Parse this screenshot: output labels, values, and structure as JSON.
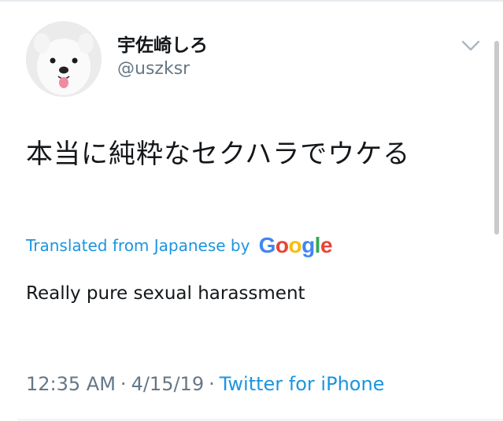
{
  "user": {
    "display_name": "宇佐崎しろ",
    "handle": "@uszksr",
    "avatar_icon": "white-dog-avatar-icon"
  },
  "tweet": {
    "text": "本当に純粋なセクハラでウケる"
  },
  "translation": {
    "label": "Translated from Japanese by",
    "provider_letters": [
      "G",
      "o",
      "o",
      "g",
      "l",
      "e"
    ],
    "text": "Really pure sexual harassment"
  },
  "meta": {
    "time": "12:35 AM",
    "separator": "·",
    "date": "4/15/19",
    "source": "Twitter for iPhone"
  },
  "icons": {
    "menu": "chevron-down-icon"
  },
  "colors": {
    "primary_text": "#14171a",
    "secondary_text": "#657786",
    "link": "#1b95e0",
    "google_blue": "#4285f4",
    "google_red": "#ea4335",
    "google_yellow": "#fbbc05",
    "google_green": "#34a853"
  }
}
